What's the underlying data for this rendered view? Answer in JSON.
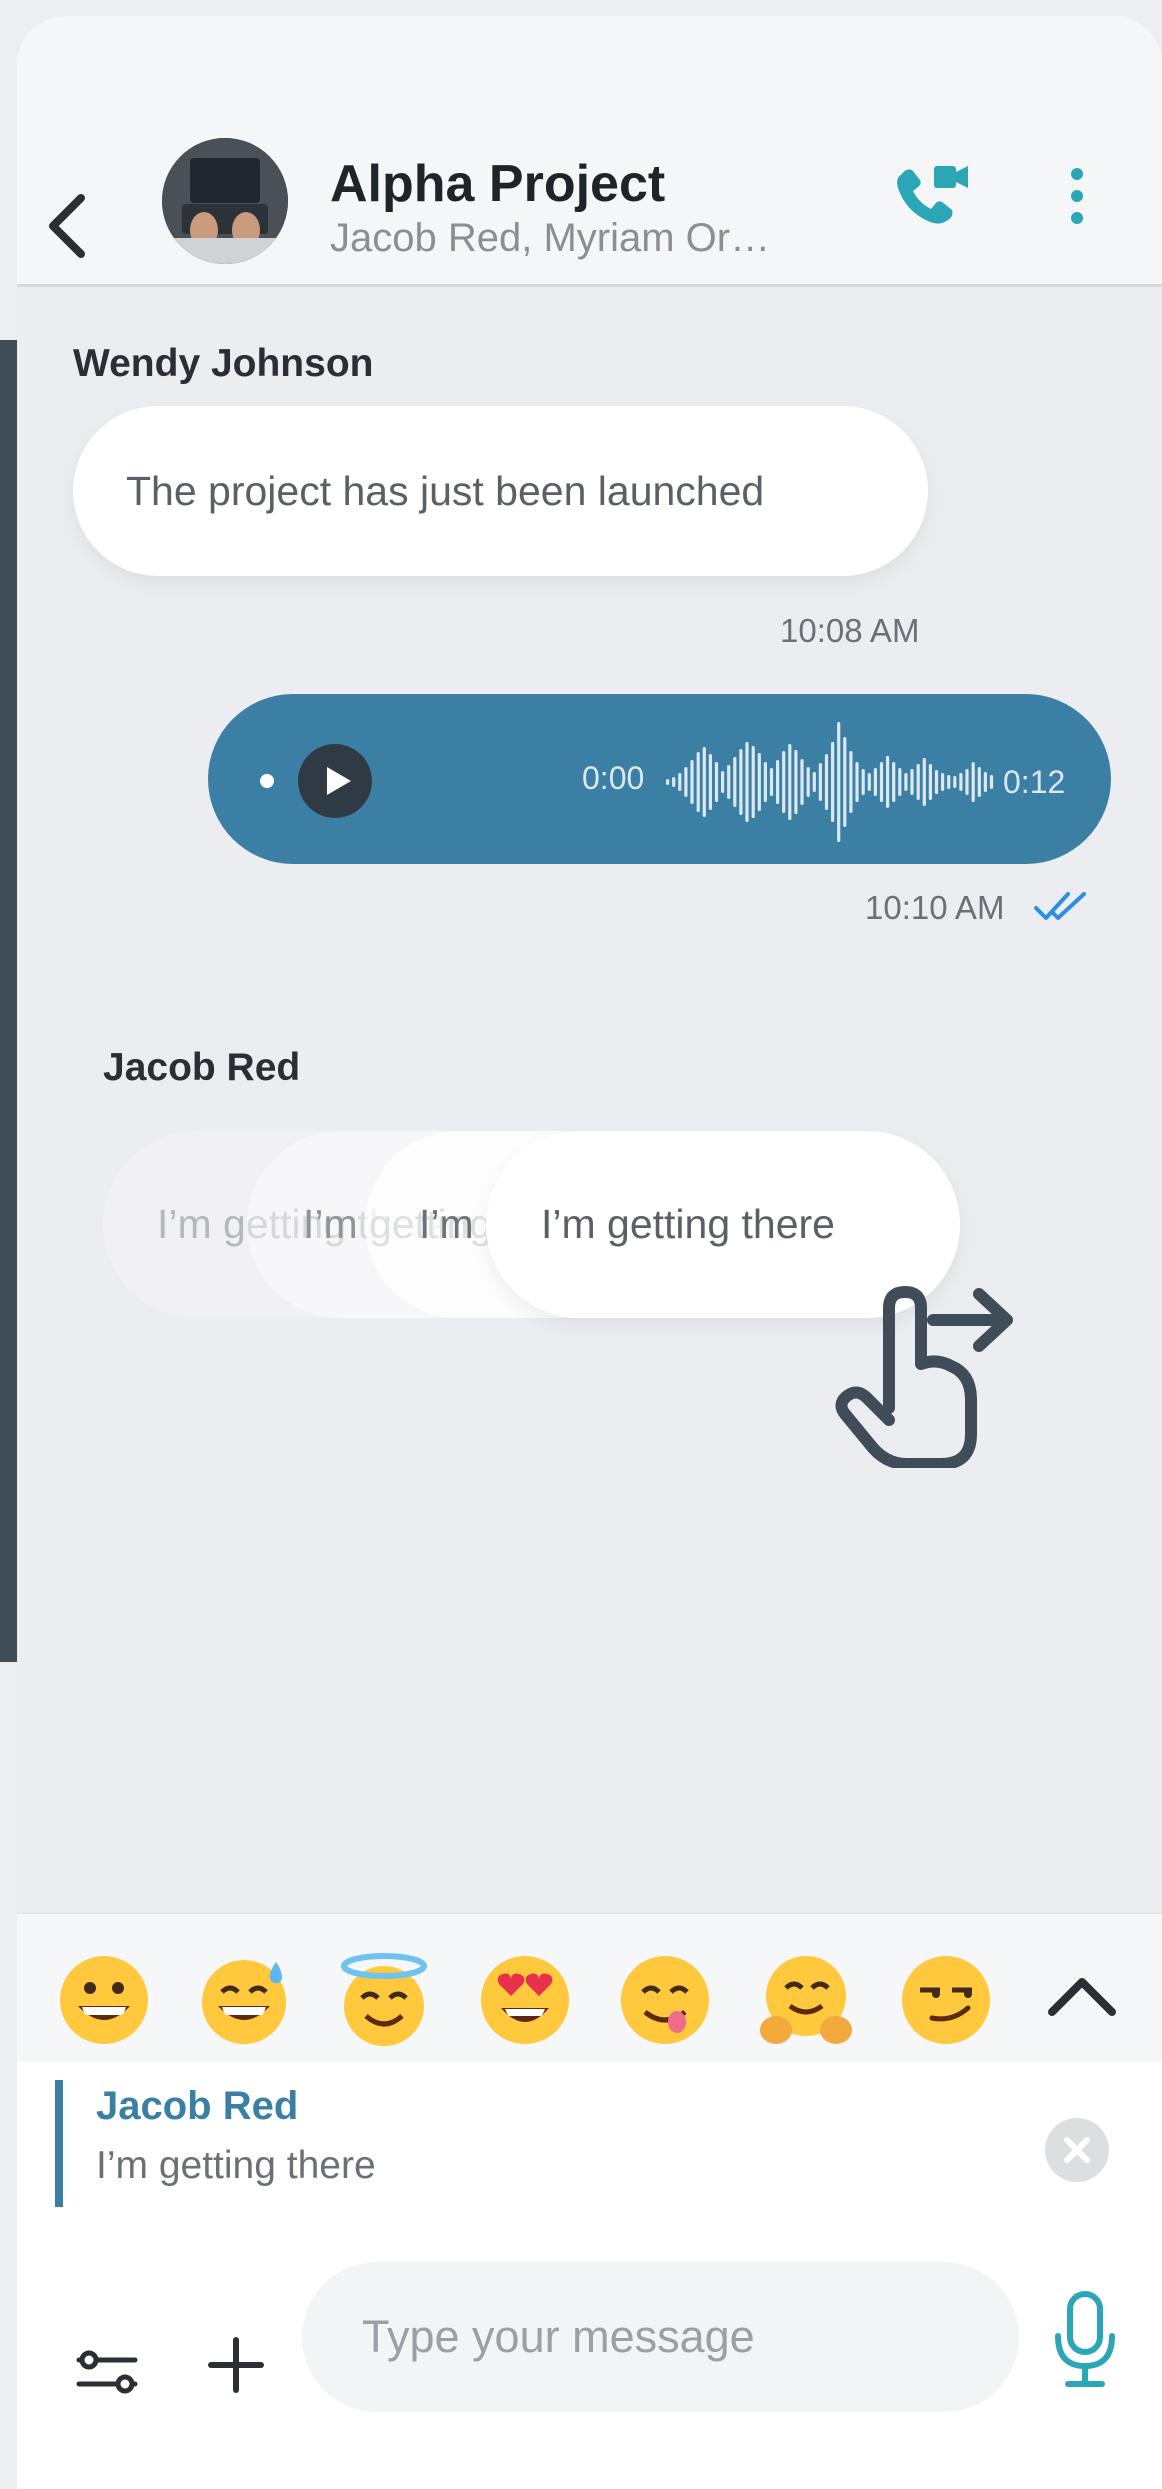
{
  "header": {
    "title": "Alpha Project",
    "subtitle": "Jacob Red, Myriam Or…"
  },
  "messages": [
    {
      "sender": "Wendy Johnson",
      "text": "The project has just been launched",
      "time": "10:08 AM"
    },
    {
      "type": "voice",
      "start": "0:00",
      "duration": "0:12",
      "time": "10:10 AM",
      "status": "read"
    },
    {
      "sender": "Jacob Red",
      "text": "I’m getting there",
      "ghost_fragments": [
        "I’m getting there",
        "I’m getting there",
        "I’m getting there"
      ]
    }
  ],
  "emojis": [
    "grinning-face",
    "grinning-face-with-sweat",
    "smiling-face-with-halo",
    "smiling-face-with-heart-eyes",
    "face-savoring-food",
    "hugging-face",
    "smirking-face"
  ],
  "reply": {
    "name": "Jacob Red",
    "text": "I’m getting there"
  },
  "composer": {
    "placeholder": "Type your message",
    "value": ""
  },
  "colors": {
    "accent": "#3b7fa4",
    "call_icon": "#2ba6b7",
    "read_ticks": "#2d8fe0",
    "background": "#ecedf1"
  }
}
